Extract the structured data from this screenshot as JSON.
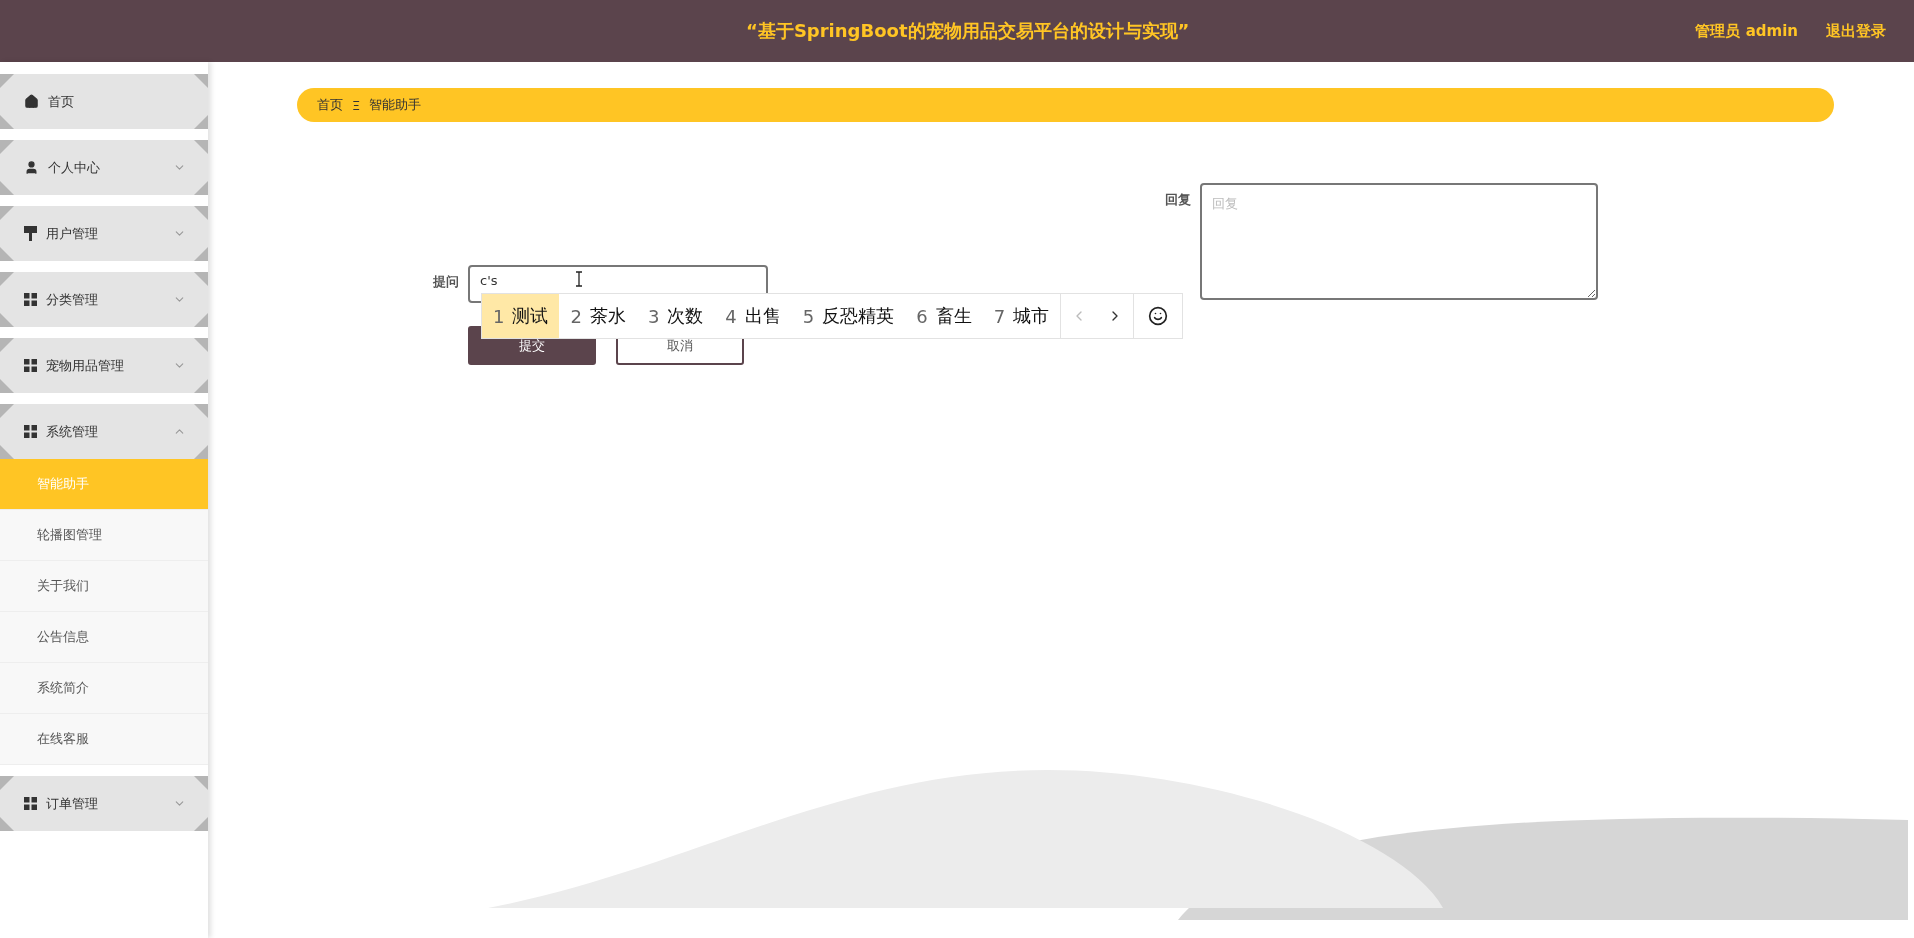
{
  "header": {
    "title": "“基于SpringBoot的宠物用品交易平台的设计与实现”",
    "user": "管理员 admin",
    "logout": "退出登录"
  },
  "sidebar": {
    "items": [
      {
        "label": "首页",
        "kind": "home"
      },
      {
        "label": "个人中心",
        "kind": "user",
        "expanded": false
      },
      {
        "label": "用户管理",
        "kind": "brush",
        "expanded": false
      },
      {
        "label": "分类管理",
        "kind": "grid",
        "expanded": false
      },
      {
        "label": "宠物用品管理",
        "kind": "grid",
        "expanded": false
      },
      {
        "label": "系统管理",
        "kind": "grid",
        "expanded": true,
        "children": [
          {
            "label": "智能助手",
            "selected": true
          },
          {
            "label": "轮播图管理",
            "selected": false
          },
          {
            "label": "关于我们",
            "selected": false
          },
          {
            "label": "公告信息",
            "selected": false
          },
          {
            "label": "系统简介",
            "selected": false
          },
          {
            "label": "在线客服",
            "selected": false
          }
        ]
      },
      {
        "label": "订单管理",
        "kind": "grid",
        "expanded": false
      }
    ]
  },
  "breadcrumb": {
    "items": [
      "首页",
      "智能助手"
    ],
    "separator": "Ξ"
  },
  "form": {
    "question": {
      "label": "提问",
      "value": "c's"
    },
    "reply": {
      "label": "回复",
      "placeholder": "回复"
    },
    "buttons": [
      {
        "label": "提交",
        "kind": "primary"
      },
      {
        "label": "取消",
        "kind": "default"
      }
    ]
  },
  "ime": {
    "candidates": [
      {
        "index": "1",
        "text": "测试",
        "selected": true
      },
      {
        "index": "2",
        "text": "茶水",
        "selected": false
      },
      {
        "index": "3",
        "text": "次数",
        "selected": false
      },
      {
        "index": "4",
        "text": "出售",
        "selected": false
      },
      {
        "index": "5",
        "text": "反恐精英",
        "selected": false
      },
      {
        "index": "6",
        "text": "畜生",
        "selected": false
      },
      {
        "index": "7",
        "text": "城市",
        "selected": false
      }
    ]
  }
}
